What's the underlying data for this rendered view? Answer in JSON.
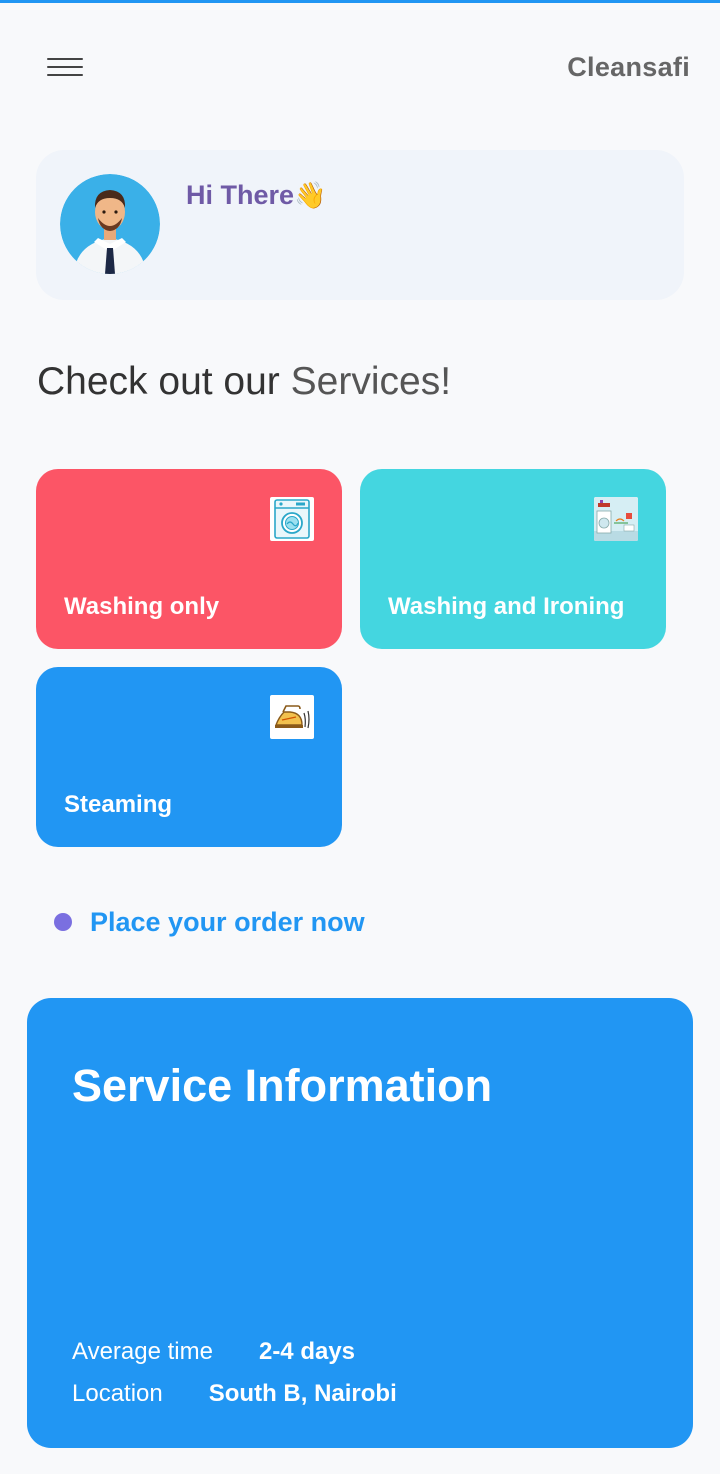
{
  "header": {
    "menu_icon": "hamburger-icon",
    "title": "Cleansafi"
  },
  "greeting": {
    "text": "Hi There",
    "emoji": "👋"
  },
  "services": {
    "heading_prefix": "Check out our",
    "heading_accent": "Services!",
    "items": [
      {
        "label": "Washing only",
        "color": "#fc5566",
        "icon": "washing-machine-icon"
      },
      {
        "label": "Washing and Ironing",
        "color": "#44d6e0",
        "icon": "laundry-room-icon"
      },
      {
        "label": "Steaming",
        "color": "#2196F3",
        "icon": "iron-icon"
      }
    ]
  },
  "order": {
    "label": "Place your order now"
  },
  "service_info": {
    "title": "Service Information",
    "average_time_label": "Average time",
    "average_time_value": "2-4 days",
    "location_label": "Location",
    "location_value": "South B, Nairobi"
  },
  "colors": {
    "accent": "#2196F3",
    "greeting_text": "#6f5aa6",
    "dot": "#7a6fe0"
  }
}
